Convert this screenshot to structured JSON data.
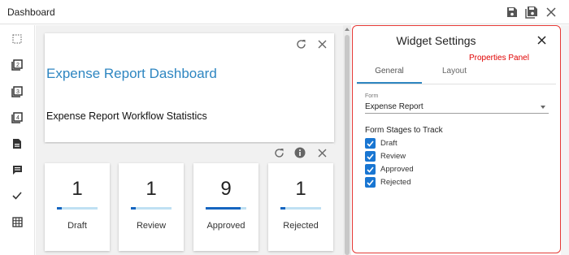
{
  "app": {
    "title": "Dashboard"
  },
  "toolbar": {
    "icons": [
      "save-icon",
      "save-as-icon",
      "close-icon"
    ]
  },
  "sidebar": {
    "items": [
      "select-area-icon",
      "two-box-icon",
      "three-box-icon",
      "four-box-icon",
      "document-icon",
      "comment-icon",
      "checkmark-icon",
      "grid-icon"
    ]
  },
  "widgets": {
    "title_widget": {
      "title": "Expense Report Dashboard",
      "subtitle": "Expense Report Workflow Statistics"
    },
    "stats_widget": {
      "cards": [
        {
          "label": "Draft",
          "value": "1",
          "fill": 0.12
        },
        {
          "label": "Review",
          "value": "1",
          "fill": 0.12
        },
        {
          "label": "Approved",
          "value": "9",
          "fill": 0.86
        },
        {
          "label": "Rejected",
          "value": "1",
          "fill": 0.12
        }
      ]
    }
  },
  "settings_panel": {
    "title": "Widget Settings",
    "annotation": "Properties Panel",
    "tabs": [
      "General",
      "Layout"
    ],
    "active_tab": "General",
    "form_caption": "Form",
    "form_value": "Expense Report",
    "stages_title": "Form Stages to Track",
    "stages": [
      {
        "label": "Draft",
        "checked": true
      },
      {
        "label": "Review",
        "checked": true
      },
      {
        "label": "Approved",
        "checked": true
      },
      {
        "label": "Rejected",
        "checked": true
      }
    ]
  },
  "colors": {
    "accent": "#2e86c1",
    "checkbox": "#1976d2",
    "panel_border": "#e53935",
    "annotation": "#e00000"
  }
}
